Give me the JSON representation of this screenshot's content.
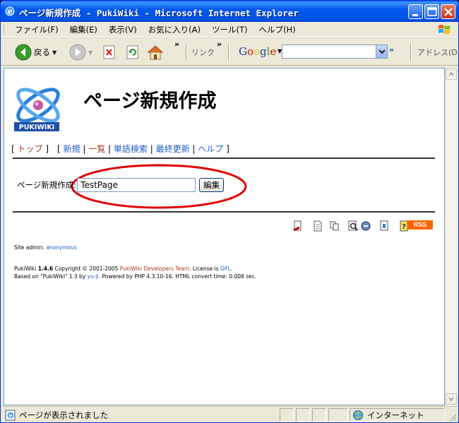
{
  "window": {
    "title": "ページ新規作成 - PukiWiki - Microsoft Internet Explorer"
  },
  "menu": {
    "items": [
      "ファイル(F)",
      "編集(E)",
      "表示(V)",
      "お気に入り(A)",
      "ツール(T)",
      "ヘルプ(H)"
    ]
  },
  "toolbar": {
    "back_label": "戻る",
    "links_label": "リンク",
    "google_label": "Google",
    "search_value": "",
    "address_label": "アドレス(D)"
  },
  "page": {
    "title": "ページ新規作成",
    "logo_text": "PUKIWIKI",
    "nav": {
      "top": "トップ",
      "new": "新規",
      "list": "一覧",
      "search": "単語検索",
      "recent": "最終更新",
      "help": "ヘルプ"
    },
    "form": {
      "label": "ページ新規作成:",
      "input_value": "TestPage",
      "button_label": "編集"
    },
    "rss_label": "RSS",
    "site_admin_label": "Site admin:",
    "site_admin_name": "anonymous",
    "footer": {
      "line1_a": "PukiWiki",
      "line1_version": "1.4.6",
      "line1_b": "Copyright © 2001-2005",
      "line1_team": "PukiWiki Developers Team",
      "line1_c": ". License is",
      "line1_gpl": "GPL",
      "line1_d": ".",
      "line2_a": "Based on \"PukiWiki\" 1.3 by",
      "line2_author": "yu-ji",
      "line2_b": ". Powered by PHP 4.3.10-16. HTML convert time: 0.008 sec."
    }
  },
  "status": {
    "text": "ページが表示されました",
    "zone": "インターネット"
  },
  "colors": {
    "link": "#215dc6",
    "visited_link": "#a63d21",
    "annotation": "#e00000",
    "rss": "#ff6600"
  }
}
